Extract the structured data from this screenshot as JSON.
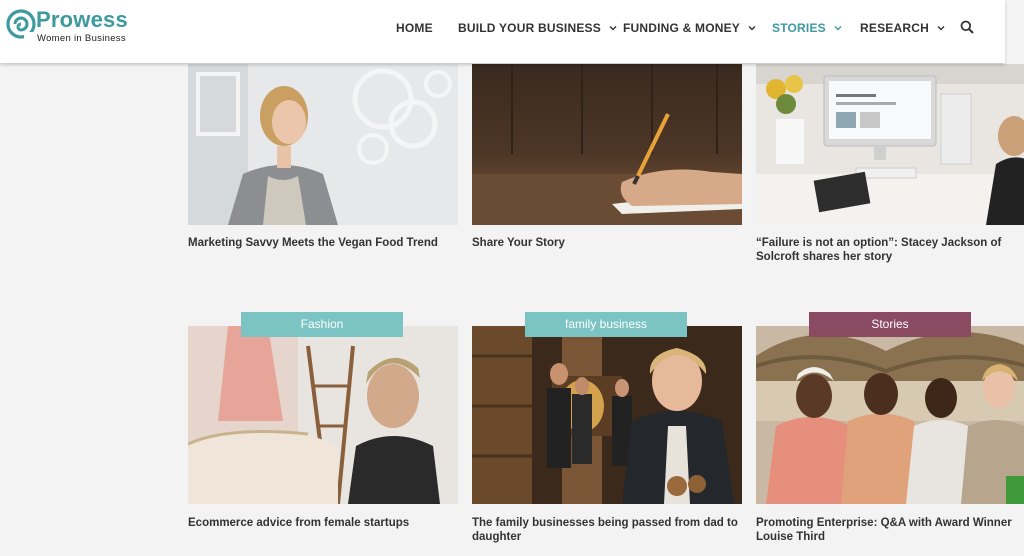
{
  "brand": {
    "title": "Prowess",
    "subtitle": "Women in Business",
    "accent_color": "#3d9a9e"
  },
  "nav": {
    "items": [
      {
        "label": "HOME",
        "has_dropdown": false,
        "active": false
      },
      {
        "label": "BUILD YOUR BUSINESS",
        "has_dropdown": true,
        "active": false
      },
      {
        "label": "FUNDING & MONEY",
        "has_dropdown": true,
        "active": false
      },
      {
        "label": "STORIES",
        "has_dropdown": true,
        "active": true
      },
      {
        "label": "RESEARCH",
        "has_dropdown": true,
        "active": false
      }
    ],
    "search_icon": "search-icon"
  },
  "cards": [
    {
      "title": "Marketing Savvy Meets the Vegan Food Trend",
      "badge": null
    },
    {
      "title": "Share Your Story",
      "badge": null
    },
    {
      "title": "“Failure is not an option”: Stacey Jackson of Solcroft shares her story",
      "badge": null
    },
    {
      "title": "Ecommerce advice from female startups",
      "badge": "Fashion",
      "badge_color": "#7cc3c4"
    },
    {
      "title": "The family businesses being passed from dad to daughter",
      "badge": "family business",
      "badge_color": "#7cc3c4"
    },
    {
      "title": "Promoting Enterprise: Q&A with Award Winner Louise Third",
      "badge": "Stories",
      "badge_color": "#8a4a62"
    }
  ]
}
